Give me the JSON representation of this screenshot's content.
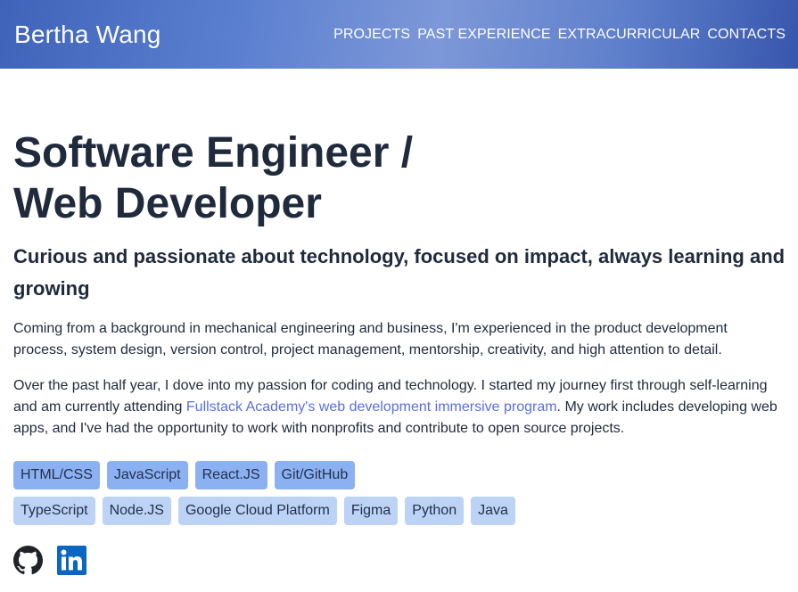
{
  "brand": {
    "name": "Bertha Wang"
  },
  "nav": {
    "items": [
      {
        "label": "PROJECTS"
      },
      {
        "label": "PAST EXPERIENCE"
      },
      {
        "label": "EXTRACURRICULAR"
      },
      {
        "label": "CONTACTS"
      }
    ]
  },
  "hero": {
    "headline_line1": "Software Engineer /",
    "headline_line2": "Web Developer",
    "subheadline": "Curious and passionate about technology, focused on impact, always learning and growing",
    "paragraph1": "Coming from a background in mechanical engineering and business, I'm experienced in the product development process, system design, version control, project management, mentorship, creativity, and high attention to detail.",
    "paragraph2_before": "Over the past half year, I dove into my passion for coding and technology. I started my journey first through self-learning and am currently attending ",
    "paragraph2_link": "Fullstack Academy's web development immersive program",
    "paragraph2_after": ". My work includes developing web apps, and I've had the opportunity to work with nonprofits and contribute to open source projects."
  },
  "skills": {
    "row1": [
      "HTML/CSS",
      "JavaScript",
      "React.JS",
      "Git/GitHub"
    ],
    "row2": [
      "TypeScript",
      "Node.JS",
      "Google Cloud Platform",
      "Figma",
      "Python",
      "Java"
    ]
  },
  "social": {
    "icons": [
      "github-icon",
      "linkedin-icon"
    ]
  },
  "colors": {
    "nav_gradient_start": "#3f63b8",
    "nav_gradient_mid": "#7d98d8",
    "text": "#1f2a3c",
    "link": "#5a6ee0",
    "tag_strong": "#8cb1f2",
    "tag_light": "#bcd3f5",
    "linkedin": "#0a66c2"
  }
}
